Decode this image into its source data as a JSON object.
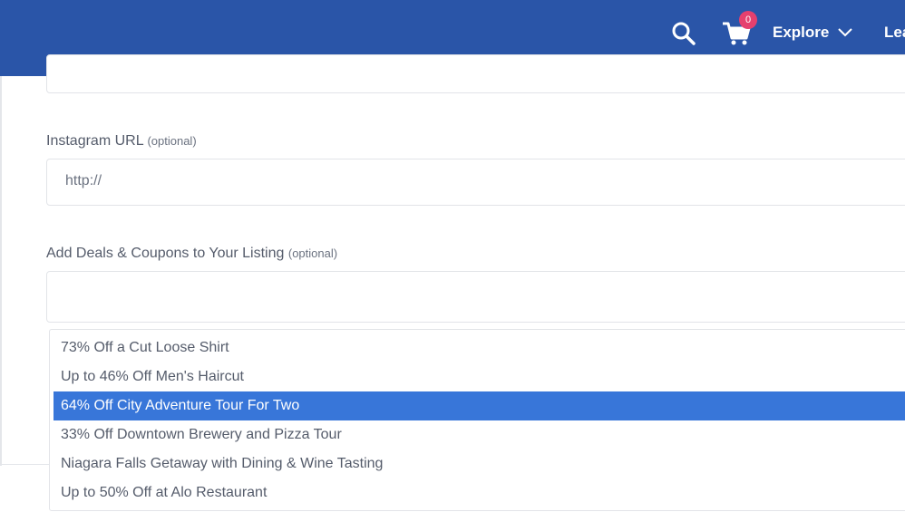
{
  "header": {
    "brand_color": "#2a55a8",
    "search_icon": "search-icon",
    "cart_icon": "cart-icon",
    "cart_count": "0",
    "explore_label": "Explore",
    "next_link_label": "Lea"
  },
  "form": {
    "instagram": {
      "label": "Instagram URL",
      "optional": "(optional)",
      "value": "http://"
    },
    "deals": {
      "label": "Add Deals & Coupons to Your Listing",
      "optional": "(optional)",
      "value": ""
    }
  },
  "dropdown": {
    "options": [
      "73% Off a Cut Loose Shirt",
      "Up to 46% Off Men's Haircut",
      "64% Off City Adventure Tour For Two",
      "33% Off Downtown Brewery and Pizza Tour",
      "Niagara Falls Getaway with Dining & Wine Tasting",
      "Up to 50% Off at Alo Restaurant"
    ],
    "highlighted_color": "#3876d9"
  }
}
